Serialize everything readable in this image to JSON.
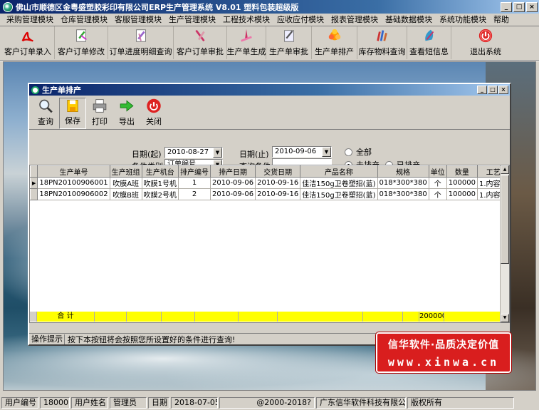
{
  "window": {
    "title": "佛山市顺德区金粤盛塑胶彩印有限公司ERP生产管理系统  V8.01  塑料包装超级版",
    "min": "_",
    "max": "□",
    "close": "×"
  },
  "menu": [
    "采购管理模块",
    "仓库管理模块",
    "客服管理模块",
    "生产管理模块",
    "工程技术模块",
    "应收应付模块",
    "报表管理模块",
    "基础数据模块",
    "系统功能模块",
    "帮助"
  ],
  "main_toolbar": [
    {
      "label": "客户订单录入",
      "icon": "pdf-icon"
    },
    {
      "label": "客户订单修改",
      "icon": "edit-document-icon"
    },
    {
      "label": "订单进度明细查询",
      "icon": "search-document-icon"
    },
    {
      "label": "客户订单审批",
      "icon": "approve-icon"
    },
    {
      "label": "生产单生成",
      "icon": "generate-icon"
    },
    {
      "label": "生产单审批",
      "icon": "approve-pen-icon"
    },
    {
      "label": "生产单排产",
      "icon": "schedule-icon"
    },
    {
      "label": "库存物料查询",
      "icon": "inventory-icon"
    },
    {
      "label": "查看短信息",
      "icon": "message-icon"
    },
    {
      "label": "退出系统",
      "icon": "exit-icon"
    }
  ],
  "child": {
    "title": "生产单排产",
    "toolbar": [
      {
        "label": "查询",
        "icon": "magnifier-icon"
      },
      {
        "label": "保存",
        "icon": "save-icon"
      },
      {
        "label": "打印",
        "icon": "printer-icon"
      },
      {
        "label": "导出",
        "icon": "export-arrow-icon"
      },
      {
        "label": "关闭",
        "icon": "close-circle-icon"
      }
    ],
    "filters": {
      "date_from_label": "日期(起)",
      "date_from": "2010-08-27",
      "date_to_label": "日期(止)",
      "date_to": "2010-09-06",
      "category_label": "条件类别",
      "category": "订单编号",
      "query_label": "查询条件",
      "query_value": "",
      "radio_all": "全部",
      "radio_unscheduled": "未排产",
      "radio_scheduled": "已排产",
      "selected": "未排产"
    },
    "grid": {
      "columns": [
        "生产单号",
        "生产班组",
        "生产机台",
        "排产编号",
        "排产日期",
        "交货日期",
        "产品名称",
        "规格",
        "单位",
        "数量",
        "工艺要求"
      ],
      "rows": [
        [
          "18PN20100906001",
          "吹膜A班",
          "吹膜1号机",
          "1",
          "2010-09-06",
          "2010-09-16",
          "佳洁150g卫卷塑招(蓝)",
          "018*300*380",
          "个",
          "100000",
          "1.内容按样稿"
        ],
        [
          "18PN20100906002",
          "吹膜B班",
          "吹膜2号机",
          "2",
          "2010-09-06",
          "2010-09-16",
          "佳洁150g卫卷塑招(蓝)",
          "018*300*380",
          "个",
          "100000",
          "1.内容按样稿"
        ]
      ],
      "total_label": "合 计",
      "total_qty": "200000"
    },
    "hint_label": "操作提示",
    "hint_text": "按下本按钮将会按照您所设置好的条件进行查询!"
  },
  "banner": {
    "line1": "信华软件·品质决定价值",
    "line2": "www.xinwa.cn"
  },
  "status": {
    "user_id_label": "用户编号",
    "user_id": "180001",
    "user_name_label": "用户姓名",
    "user_name": "管理员",
    "date_label": "日期",
    "date": "2018-07-05",
    "copyright": "@2000-2018?",
    "company": "广东信华软件科技有限公司",
    "rights": "版权所有"
  }
}
